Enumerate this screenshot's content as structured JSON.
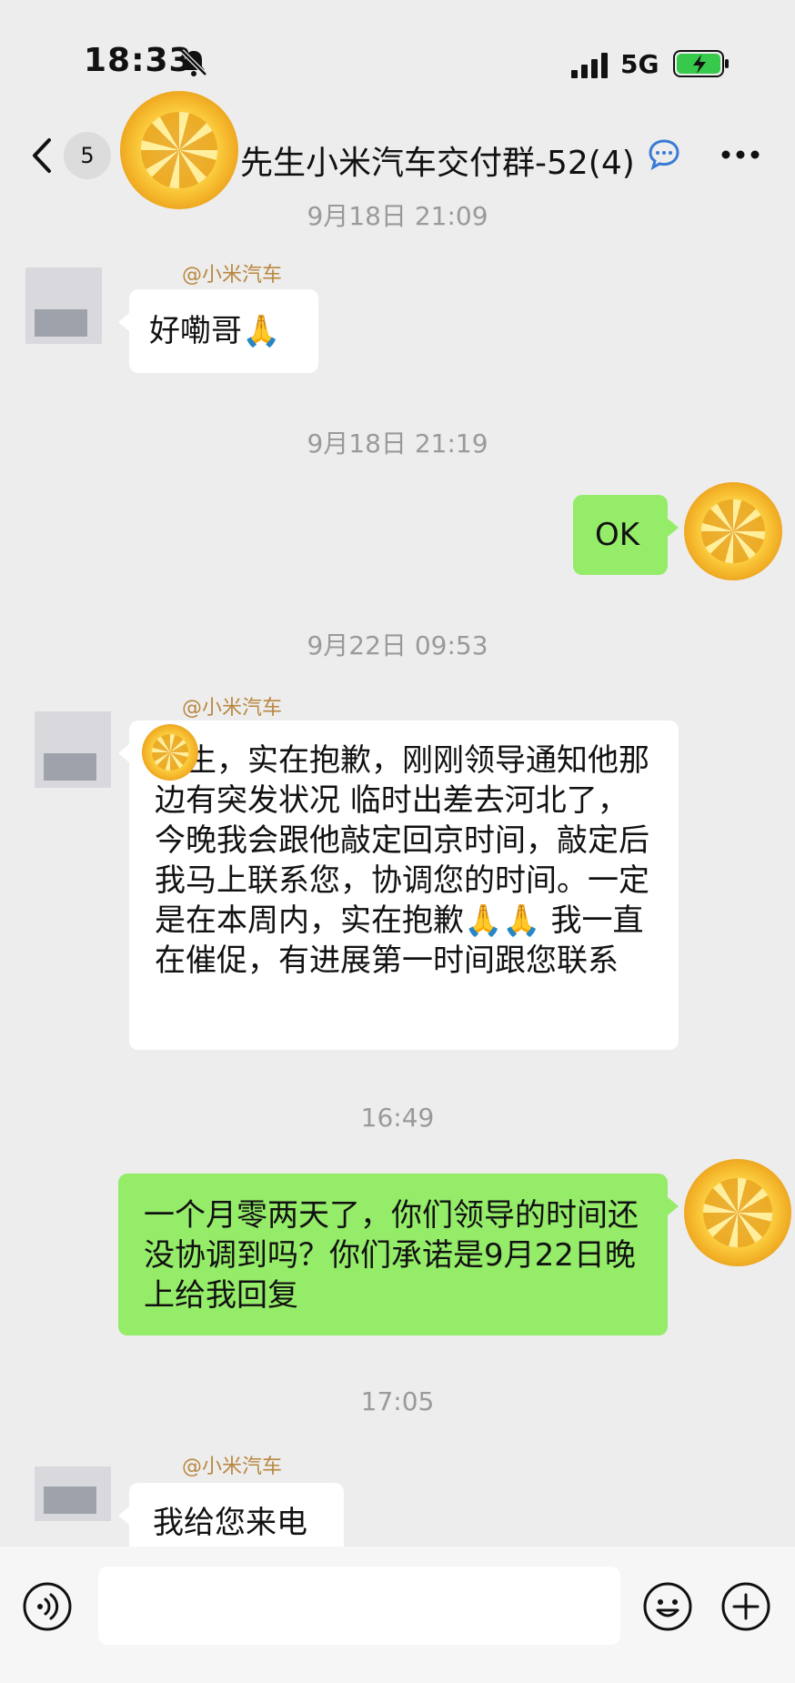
{
  "status_bar": {
    "time": "18:33",
    "network": "5G"
  },
  "header": {
    "unread_count": "5",
    "title": "先生小米汽车交付群-52(4)"
  },
  "messages": [
    {
      "type": "timestamp",
      "text": "9月18日 21:09"
    },
    {
      "type": "in",
      "sender": "@小米汽车",
      "text": "好嘞哥🙏"
    },
    {
      "type": "timestamp",
      "text": "9月18日 21:19"
    },
    {
      "type": "out",
      "text": "OK"
    },
    {
      "type": "timestamp",
      "text": "9月22日 09:53"
    },
    {
      "type": "in",
      "sender": "@小米汽车",
      "text": "先生，实在抱歉，刚刚领导通知他那边有突发状况 临时出差去河北了，今晚我会跟他敲定回京时间，敲定后我马上联系您，协调您的时间。一定是在本周内，实在抱歉🙏🙏 我一直在催促，有进展第一时间跟您联系"
    },
    {
      "type": "timestamp",
      "text": "16:49"
    },
    {
      "type": "out",
      "text": "一个月零两天了，你们领导的时间还没协调到吗？你们承诺是9月22日晚上给我回复"
    },
    {
      "type": "timestamp",
      "text": "17:05"
    },
    {
      "type": "in",
      "sender": "@小米汽车",
      "text": "我给您来电"
    }
  ],
  "icons": {
    "back": "chevron-left-icon",
    "chat_info": "chat-bubble-icon",
    "more": "more-dots-icon",
    "voice": "voice-icon",
    "emoji": "emoji-icon",
    "plus": "plus-icon"
  },
  "colors": {
    "outgoing_bubble": "#95ec69",
    "incoming_bubble": "#ffffff",
    "background": "#ededed",
    "sender_name": "#b88740"
  }
}
